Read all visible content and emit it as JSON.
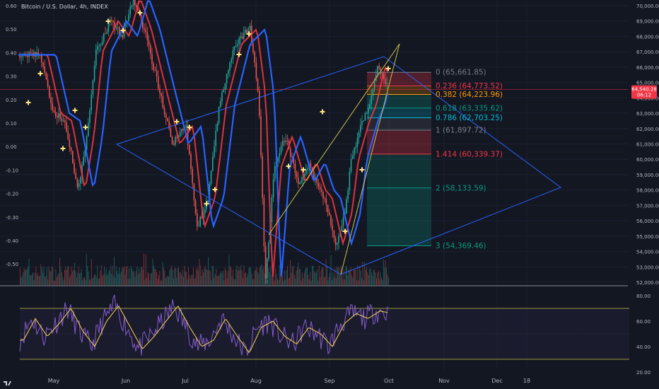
{
  "header": {
    "title": "Bitcoin / U.S. Dollar, 4h, INDEX"
  },
  "price_badge": {
    "value": "64,540.28",
    "countdown": "06:12",
    "color": "#f23645"
  },
  "colors": {
    "background": "#131722",
    "up_candle": "#26a69a",
    "down_candle": "#ef5350",
    "blue_ma": "#2962ff",
    "red_ma": "#f23645",
    "pattern_lines": "#2962ff",
    "trend_lines": "#c8c34a",
    "rsi_line": "#7e57c2",
    "rsi_signal": "#e6c84a"
  },
  "chart_data": [
    {
      "type": "line",
      "title": "Bitcoin / U.S. Dollar, 4h, INDEX",
      "x_labels": [
        "May",
        "Jun",
        "Jul",
        "Aug",
        "Sep",
        "Oct",
        "Nov",
        "Dec",
        "18"
      ],
      "left_axis_ticks": [
        "0.60",
        "0.50",
        "0.40",
        "0.30",
        "0.20",
        "0.10",
        "0.00",
        "-0.10",
        "-0.20",
        "-0.30",
        "-0.40",
        "-0.50"
      ],
      "right_axis_ticks": [
        "70,000.00",
        "69,000.00",
        "68,000.00",
        "67,000.00",
        "66,000.00",
        "65,000.00",
        "64,000.00",
        "63,000.00",
        "62,000.00",
        "61,000.00",
        "60,000.00",
        "59,000.00",
        "58,000.00",
        "57,000.00",
        "56,000.00",
        "55,000.00",
        "54,000.00",
        "53,000.00",
        "52,000.00"
      ],
      "ylim": [
        52000,
        70000
      ],
      "price_path": {
        "x": [
          "Apr 25",
          "May 1",
          "May 6",
          "May 12",
          "May 16",
          "May 20",
          "May 27",
          "Jun 1",
          "Jun 6",
          "Jun 11",
          "Jun 17",
          "Jun 24",
          "Jun 30",
          "Jul 5",
          "Jul 10",
          "Jul 15",
          "Jul 22",
          "Jul 29",
          "Aug 2",
          "Aug 5",
          "Aug 9",
          "Aug 14",
          "Aug 20",
          "Aug 25",
          "Aug 29",
          "Sep 1",
          "Sep 6",
          "Sep 10",
          "Sep 13",
          "Sep 18",
          "Sep 21",
          "Sep 25",
          "Sep 27",
          "Sep 29",
          "Sep 30"
        ],
        "y": [
          66800,
          63000,
          62500,
          58000,
          61500,
          67000,
          69000,
          68000,
          70500,
          68500,
          65000,
          61000,
          62200,
          55500,
          57500,
          63500,
          67500,
          68500,
          64000,
          52000,
          59500,
          61500,
          58500,
          59800,
          58000,
          57500,
          54500,
          56500,
          60000,
          62500,
          63500,
          66000,
          65500,
          64800,
          64540
        ]
      },
      "fibonacci": [
        {
          "level": "0",
          "value": "65,661.85",
          "color": "#787b86"
        },
        {
          "level": "0.236",
          "value": "64,773.52",
          "color": "#f23645"
        },
        {
          "level": "0.382",
          "value": "64,223.96",
          "color": "#ff9800"
        },
        {
          "level": "0.618",
          "value": "63,335.62",
          "color": "#089981"
        },
        {
          "level": "0.786",
          "value": "62,703.25",
          "color": "#00bcd4"
        },
        {
          "level": "1",
          "value": "61,897.72",
          "color": "#787b86"
        },
        {
          "level": "1.414",
          "value": "60,339.37",
          "color": "#f23645"
        },
        {
          "level": "2",
          "value": "58,133.59",
          "color": "#089981"
        },
        {
          "level": "3",
          "value": "54,369.46",
          "color": "#089981"
        }
      ]
    },
    {
      "type": "line",
      "title": "",
      "right_axis_ticks": [
        "80.00",
        "60.00",
        "40.00",
        "20.00"
      ],
      "ylim": [
        20,
        80
      ],
      "bands": [
        70,
        30
      ],
      "rsi": [
        45,
        62,
        48,
        58,
        70,
        52,
        40,
        60,
        72,
        55,
        38,
        48,
        60,
        72,
        55,
        40,
        45,
        62,
        48,
        35,
        55,
        60,
        48,
        42,
        55,
        50,
        40,
        58,
        66,
        62,
        68,
        66
      ]
    }
  ]
}
